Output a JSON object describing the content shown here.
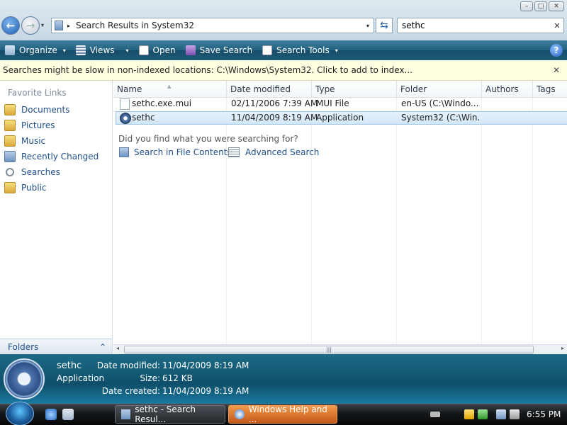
{
  "window": {
    "min_symbol": "–",
    "max_symbol": "□",
    "close_symbol": "✕"
  },
  "nav": {
    "back_symbol": "←",
    "forward_symbol": "→",
    "recent_symbol": "▾"
  },
  "address": {
    "separator": "▸",
    "path": "Search Results in System32",
    "dropdown": "▾",
    "refresh_symbol": "⇆"
  },
  "search": {
    "value": "sethc",
    "clear_symbol": "✕"
  },
  "toolbar": {
    "organize": "Organize",
    "views": "Views",
    "open": "Open",
    "save_search": "Save Search",
    "search_tools": "Search Tools",
    "dropdown": "▾",
    "help": "?"
  },
  "infobar": {
    "text": "Searches might be slow in non-indexed locations: C:\\Windows\\System32. Click to add to index...",
    "close_symbol": "✕"
  },
  "sidebar": {
    "heading": "Favorite Links",
    "items": [
      {
        "label": "Documents",
        "icon": "folder-icon"
      },
      {
        "label": "Pictures",
        "icon": "folder-icon"
      },
      {
        "label": "Music",
        "icon": "folder-icon"
      },
      {
        "label": "Recently Changed",
        "icon": "folder-icon"
      },
      {
        "label": "Searches",
        "icon": "search-icon"
      },
      {
        "label": "Public",
        "icon": "folder-icon"
      }
    ],
    "folders_label": "Folders",
    "folders_toggle": "⌃"
  },
  "columns": [
    "Name",
    "Date modified",
    "Type",
    "Folder",
    "Authors",
    "Tags"
  ],
  "sort_indicator": "▲",
  "files": [
    {
      "name": "sethc.exe.mui",
      "date": "02/11/2006 7:39 AM",
      "type": "MUI File",
      "folder": "en-US (C:\\Windo...",
      "selected": false
    },
    {
      "name": "sethc",
      "date": "11/04/2009 8:19 AM",
      "type": "Application",
      "folder": "System32 (C:\\Win...",
      "selected": true
    }
  ],
  "suggest": {
    "question": "Did you find what you were searching for?",
    "file_contents": "Search in File Contents",
    "advanced": "Advanced Search"
  },
  "scroll": {
    "left": "◂",
    "right": "▸",
    "grip": "|||"
  },
  "details": {
    "name": "sethc",
    "kind": "Application",
    "date_modified_label": "Date modified:",
    "date_modified": "11/04/2009 8:19 AM",
    "size_label": "Size:",
    "size": "612 KB",
    "date_created_label": "Date created:",
    "date_created": "11/04/2009 8:19 AM"
  },
  "taskbar": {
    "task1": "sethc - Search Resul...",
    "task2": "Windows Help and ...",
    "time": "6:55 PM"
  },
  "colors": {
    "toolbar": "#1d5b78",
    "details": "#0e4f6a",
    "link": "#1f4f8a",
    "infobar": "#ffffe1",
    "selection": "#d3e7f8"
  }
}
